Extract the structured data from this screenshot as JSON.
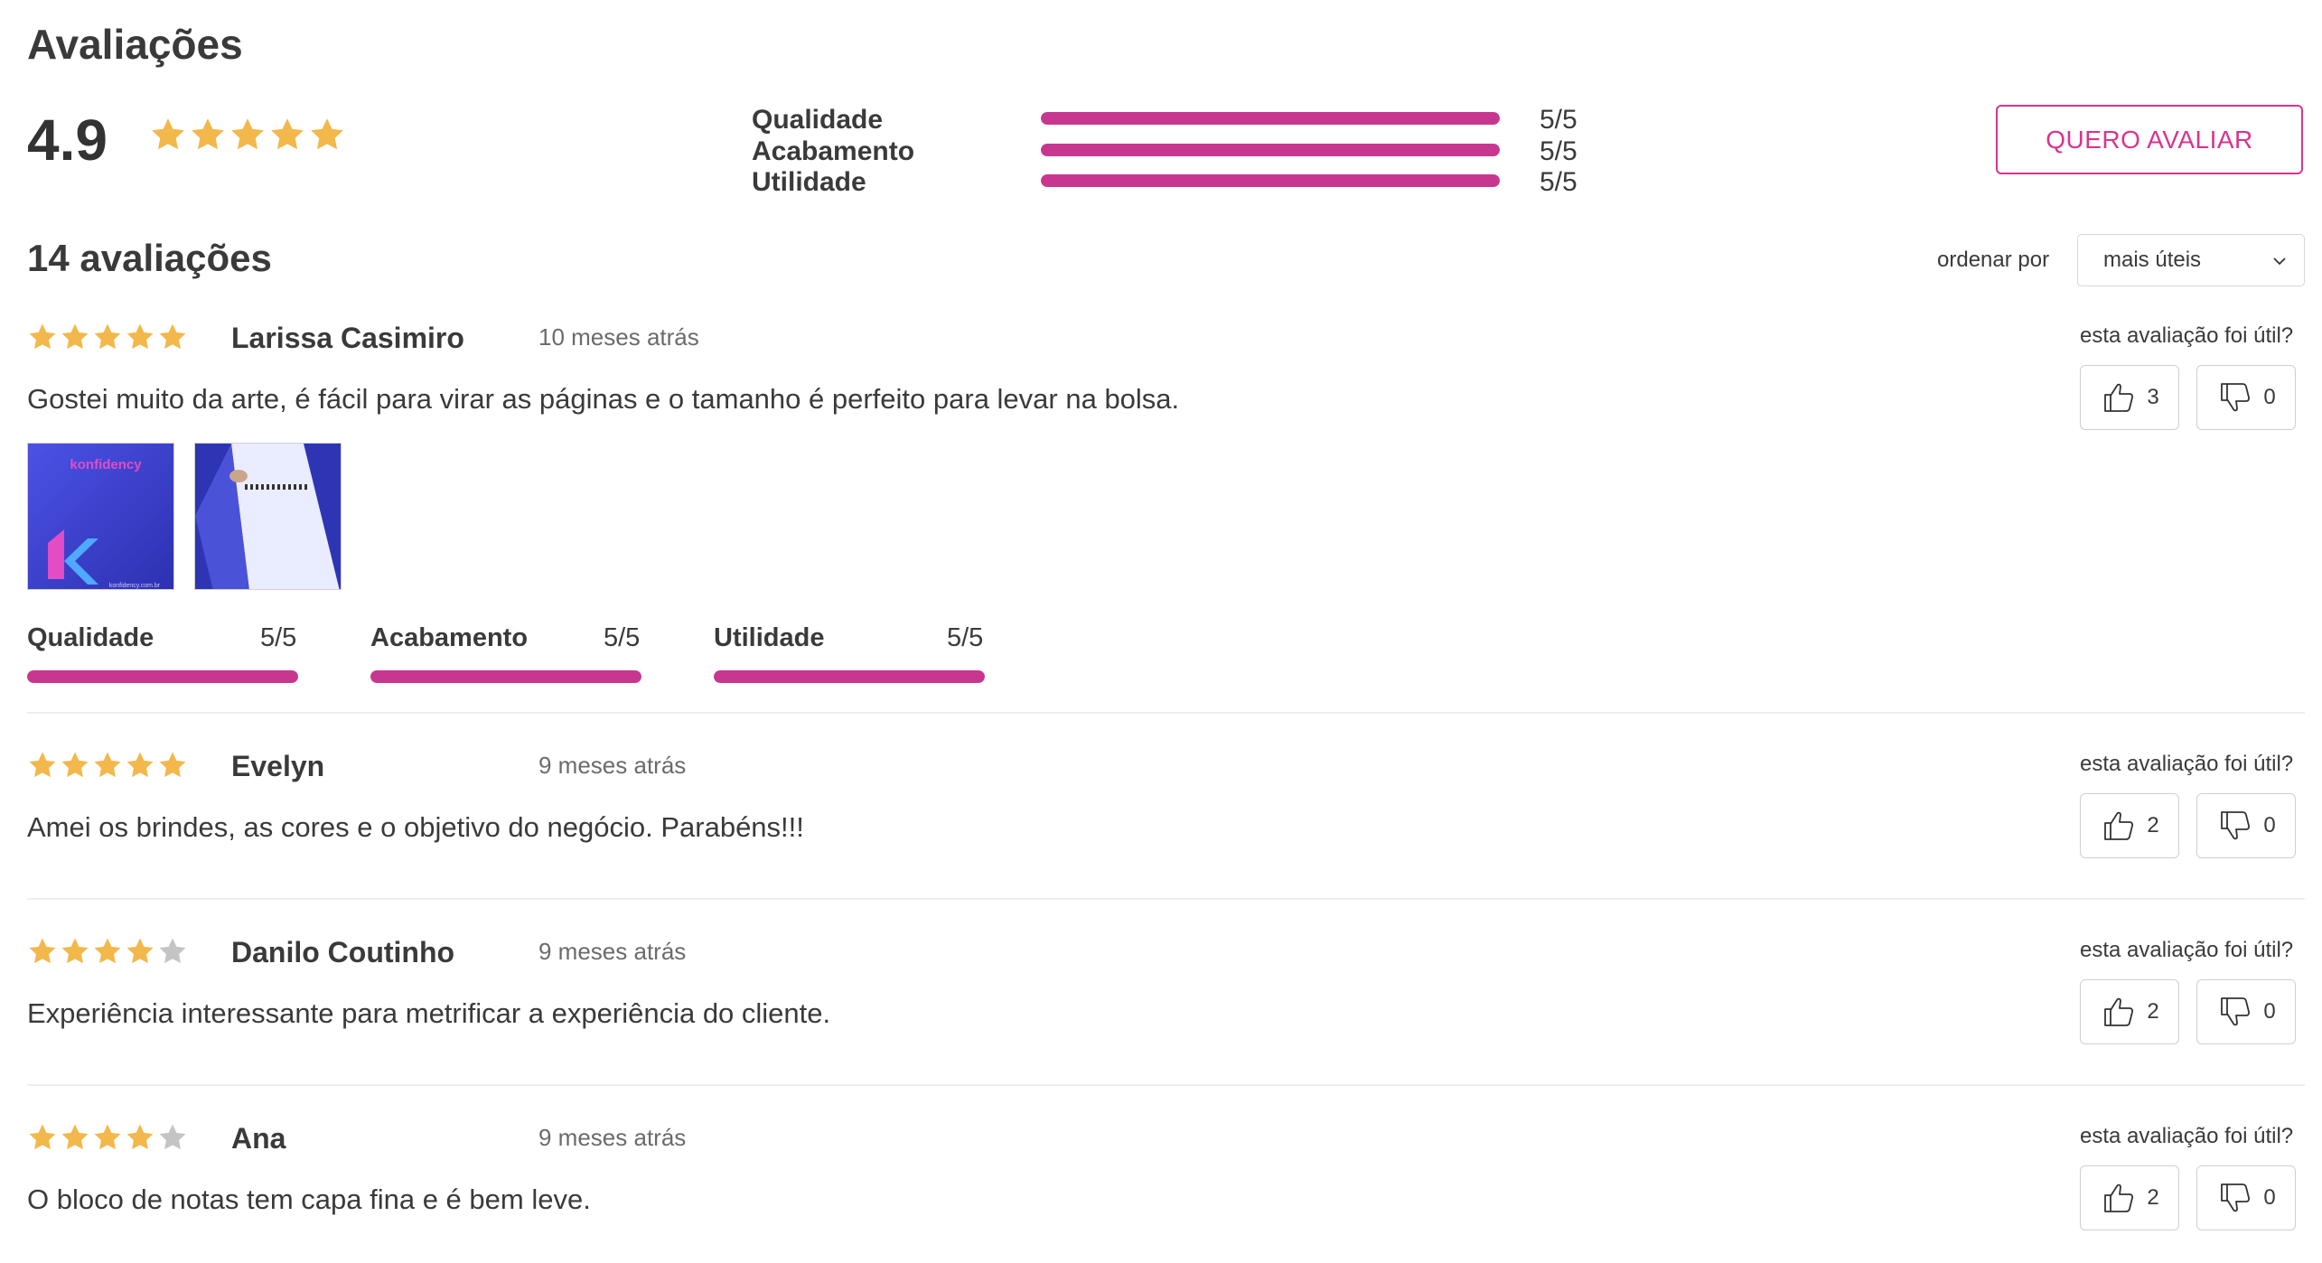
{
  "title": "Avaliações",
  "summary": {
    "average": "4.9",
    "stars": 5,
    "criteria": [
      {
        "label": "Qualidade",
        "score": "5/5",
        "fill": 1.0
      },
      {
        "label": "Acabamento",
        "score": "5/5",
        "fill": 1.0
      },
      {
        "label": "Utilidade",
        "score": "5/5",
        "fill": 1.0
      }
    ],
    "cta_label": "QUERO AVALIAR"
  },
  "reviews_header": {
    "count_label": "14 avaliações",
    "sort_label": "ordenar por",
    "sort_value": "mais úteis"
  },
  "colors": {
    "accent": "#d9348e",
    "bar": "#c8378f",
    "star_on": "#f2b84b",
    "star_off": "#c4c4c4"
  },
  "reviews": [
    {
      "stars": 5,
      "name": "Larissa Casimiro",
      "date": "10 meses atrás",
      "text": "Gostei muito da arte, é fácil para virar as páginas e o tamanho é perfeito para levar na bolsa.",
      "helpful_label": "esta avaliação foi útil?",
      "up": "3",
      "down": "0",
      "photos": [
        {
          "caption": "konfidency",
          "footer": "konfidency.com.br"
        },
        {
          "caption": ""
        }
      ],
      "criteria": [
        {
          "label": "Qualidade",
          "score": "5/5",
          "fill": 1.0
        },
        {
          "label": "Acabamento",
          "score": "5/5",
          "fill": 1.0
        },
        {
          "label": "Utilidade",
          "score": "5/5",
          "fill": 1.0
        }
      ]
    },
    {
      "stars": 5,
      "name": "Evelyn",
      "date": "9 meses atrás",
      "text": "Amei os brindes, as cores e o objetivo do negócio. Parabéns!!!",
      "helpful_label": "esta avaliação foi útil?",
      "up": "2",
      "down": "0"
    },
    {
      "stars": 4,
      "name": "Danilo Coutinho",
      "date": "9 meses atrás",
      "text": "Experiência interessante para metrificar a experiência do cliente.",
      "helpful_label": "esta avaliação foi útil?",
      "up": "2",
      "down": "0"
    },
    {
      "stars": 4,
      "name": "Ana",
      "date": "9 meses atrás",
      "text": "O bloco de notas tem capa fina e é bem leve.",
      "helpful_label": "esta avaliação foi útil?",
      "up": "2",
      "down": "0"
    }
  ]
}
